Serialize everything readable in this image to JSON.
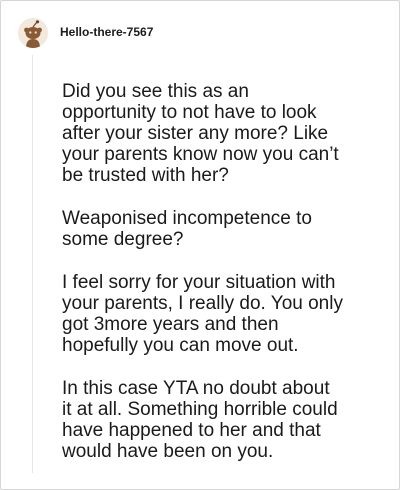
{
  "comment": {
    "username": "Hello-there-7567",
    "avatar_icon": "snoo-avatar-icon",
    "paragraphs": [
      "Did you see this as an\nopportunity to not have to look\nafter your sister any more? Like\nyour parents know now you can’t\nbe trusted with her?",
      "Weaponised incompetence to\nsome degree?",
      "I feel sorry for your situation with\nyour parents, I really do. You only\ngot 3more years and then\nhopefully you can move out.",
      "In this case YTA no doubt about\nit at all. Something horrible could\nhave happened to her and that\nwould have been on you."
    ]
  },
  "colors": {
    "avatar_bg": "#f2e8dc",
    "avatar_figure": "#8a5a34",
    "text": "#1a1a1a",
    "border": "#d6d6d6"
  }
}
